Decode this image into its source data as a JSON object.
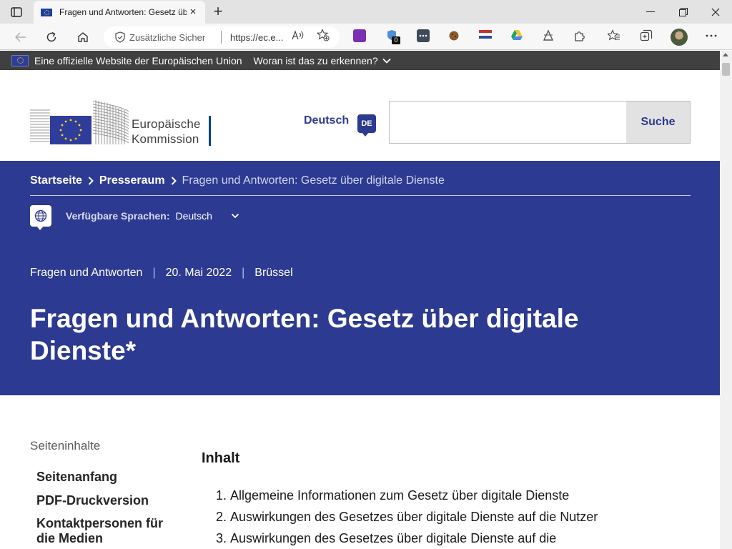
{
  "browser": {
    "tab_title": "Fragen und Antworten: Gesetz üb",
    "tab_close": "×",
    "new_tab": "+",
    "security_label": "Zusätzliche Sicher",
    "url": "https://ec.e...",
    "extension_badge": "0"
  },
  "banner": {
    "official_text": "Eine offizielle Website der Europäischen Union",
    "how_to_know": "Woran ist das zu erkennen?"
  },
  "header": {
    "logo_line1": "Europäische",
    "logo_line2": "Kommission",
    "language_label": "Deutsch",
    "language_code": "DE",
    "search_button": "Suche",
    "search_value": ""
  },
  "breadcrumb": {
    "home": "Startseite",
    "press": "Presseraum",
    "current": "Fragen und Antworten: Gesetz über digitale Dienste"
  },
  "languages": {
    "label": "Verfügbare Sprachen:",
    "selected": "Deutsch"
  },
  "meta": {
    "type": "Fragen und Antworten",
    "date": "20. Mai 2022",
    "place": "Brüssel"
  },
  "title": "Fragen und Antworten: Gesetz über digitale Dienste*",
  "sidebar": {
    "heading": "Seiteninhalte",
    "links": [
      "Seitenanfang",
      "PDF-Druckversion",
      "Kontaktpersonen für die Medien"
    ]
  },
  "content": {
    "heading": "Inhalt",
    "toc": [
      {
        "num": "1.",
        "text": "Allgemeine Informationen zum Gesetz über digitale Dienste"
      },
      {
        "num": "2.",
        "text": "Auswirkungen des Gesetzes über digitale Dienste auf die Nutzer"
      },
      {
        "num": "3.",
        "text": "Auswirkungen des Gesetzes über digitale Dienste auf die"
      }
    ]
  },
  "colors": {
    "hero_bg": "#2d3a91",
    "link_blue": "#2c3a8f",
    "banner_bg": "#404040"
  }
}
